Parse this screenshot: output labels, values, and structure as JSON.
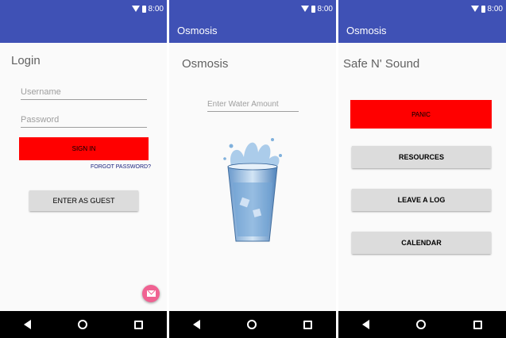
{
  "status": {
    "time": "8:00"
  },
  "screen1": {
    "title": "Login",
    "username_placeholder": "Username",
    "password_placeholder": "Password",
    "sign_in_label": "SIGN IN",
    "forgot_password_label": "FORGOT PASSWORD?",
    "guest_label": "ENTER AS GUEST",
    "fab_icon": "email-icon"
  },
  "screen2": {
    "app_title": "Osmosis",
    "heading": "Osmosis",
    "water_placeholder": "Enter Water Amount",
    "image": "water-glass"
  },
  "screen3": {
    "app_title": "Osmosis",
    "heading": "Safe N' Sound",
    "panic_label": "PANIC",
    "resources_label": "RESOURCES",
    "log_label": "LEAVE A LOG",
    "calendar_label": "CALENDAR"
  },
  "colors": {
    "primary": "#3f51b5",
    "panic": "#ff0000",
    "fab": "#f06292"
  }
}
